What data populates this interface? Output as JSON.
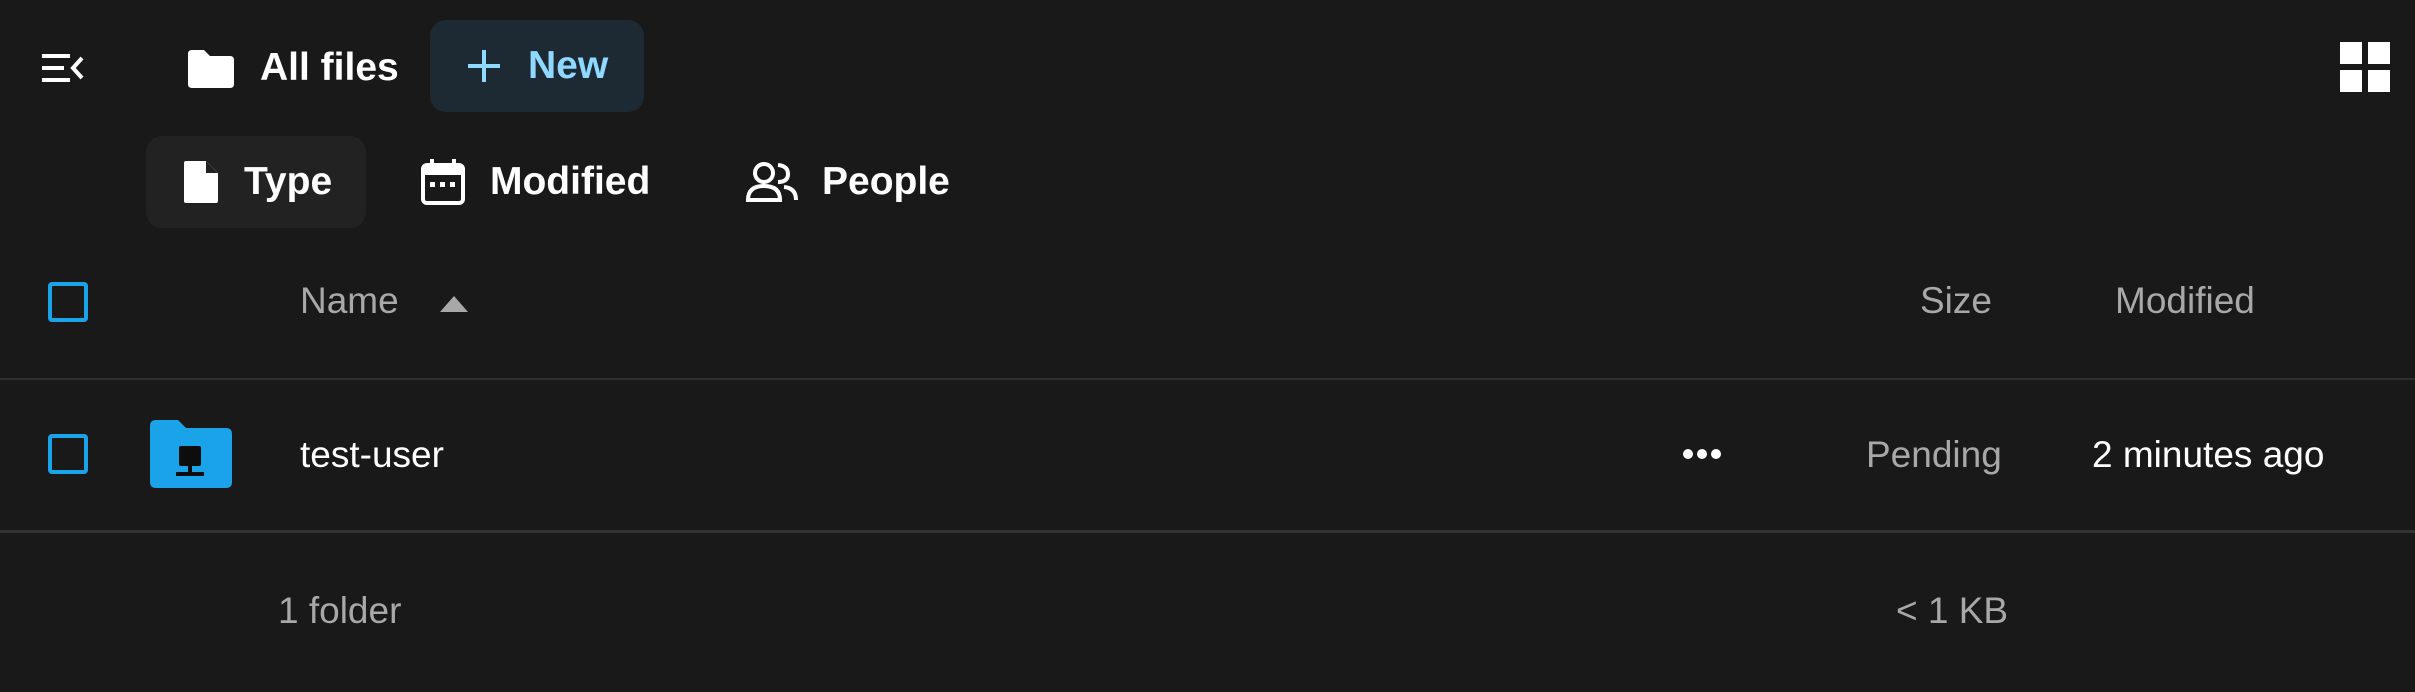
{
  "toolbar": {
    "breadcrumb_label": "All files",
    "new_button_label": "New"
  },
  "filters": {
    "type_label": "Type",
    "modified_label": "Modified",
    "people_label": "People"
  },
  "table": {
    "headers": {
      "name": "Name",
      "size": "Size",
      "modified": "Modified"
    },
    "sort": {
      "column": "name",
      "direction": "ascending"
    },
    "rows": [
      {
        "name": "test-user",
        "size": "Pending",
        "modified": "2 minutes ago",
        "icon": "shared-folder-icon"
      }
    ],
    "footer": {
      "summary": "1 folder",
      "total_size": "< 1 KB"
    }
  },
  "colors": {
    "background": "#191919",
    "accent": "#1aa3e8",
    "new_button_text": "#8fd8ff",
    "new_button_bg": "#1e2a33"
  }
}
